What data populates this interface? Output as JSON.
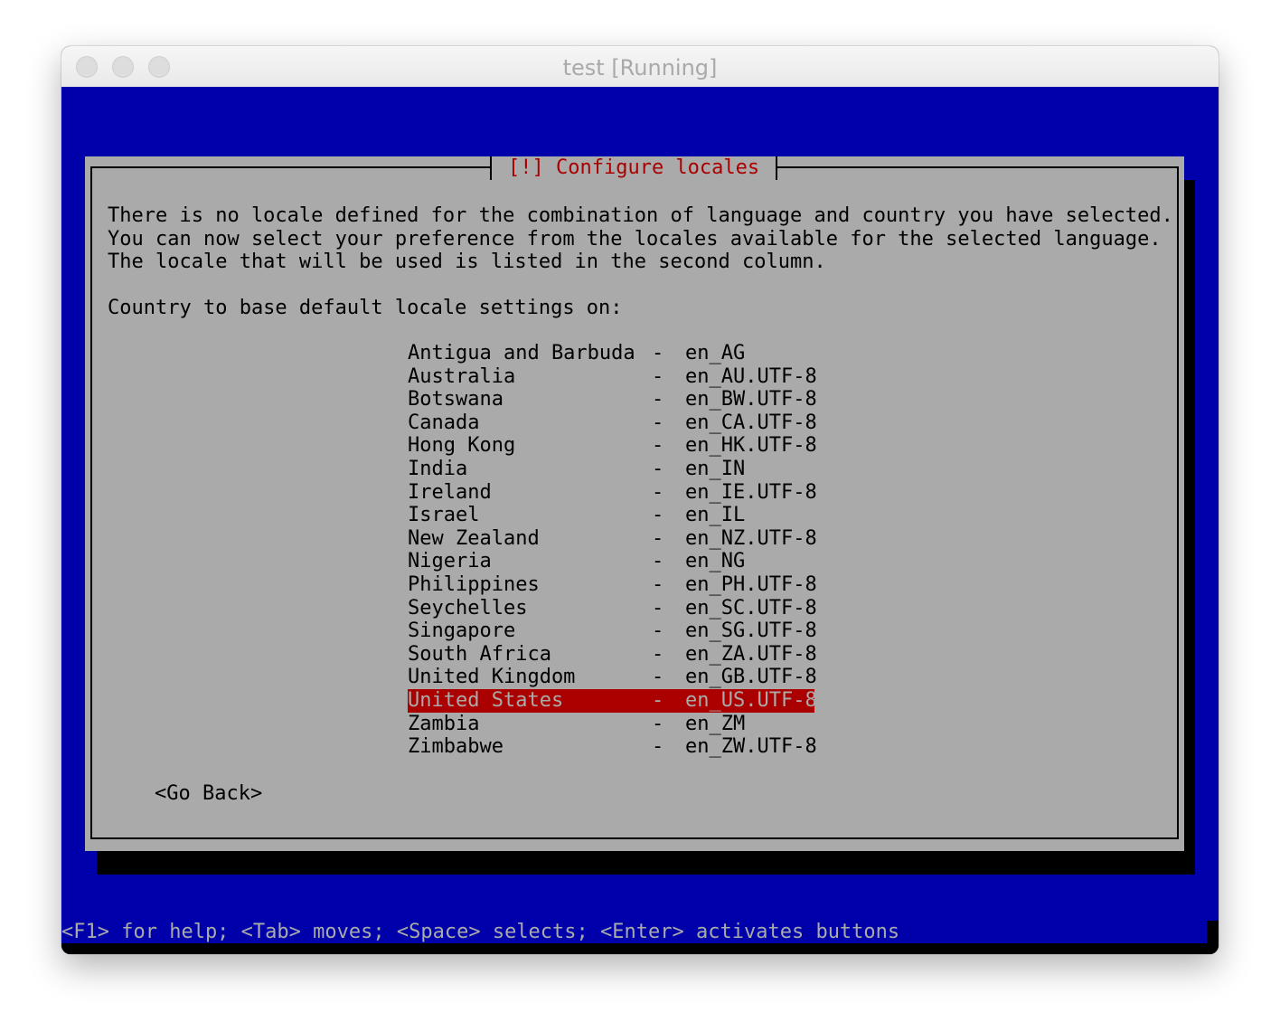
{
  "window": {
    "title": "test [Running]"
  },
  "dialog": {
    "title": "[!] Configure locales",
    "paragraph": [
      "There is no locale defined for the combination of language and country you have selected.",
      "You can now select your preference from the locales available for the selected language.",
      "The locale that will be used is listed in the second column."
    ],
    "prompt": "Country to base default locale settings on:",
    "separator": "-",
    "locales": [
      {
        "country": "Antigua and Barbuda",
        "code": "en_AG"
      },
      {
        "country": "Australia",
        "code": "en_AU.UTF-8"
      },
      {
        "country": "Botswana",
        "code": "en_BW.UTF-8"
      },
      {
        "country": "Canada",
        "code": "en_CA.UTF-8"
      },
      {
        "country": "Hong Kong",
        "code": "en_HK.UTF-8"
      },
      {
        "country": "India",
        "code": "en_IN"
      },
      {
        "country": "Ireland",
        "code": "en_IE.UTF-8"
      },
      {
        "country": "Israel",
        "code": "en_IL"
      },
      {
        "country": "New Zealand",
        "code": "en_NZ.UTF-8"
      },
      {
        "country": "Nigeria",
        "code": "en_NG"
      },
      {
        "country": "Philippines",
        "code": "en_PH.UTF-8"
      },
      {
        "country": "Seychelles",
        "code": "en_SC.UTF-8"
      },
      {
        "country": "Singapore",
        "code": "en_SG.UTF-8"
      },
      {
        "country": "South Africa",
        "code": "en_ZA.UTF-8"
      },
      {
        "country": "United Kingdom",
        "code": "en_GB.UTF-8"
      },
      {
        "country": "United States",
        "code": "en_US.UTF-8",
        "selected": true
      },
      {
        "country": "Zambia",
        "code": "en_ZM"
      },
      {
        "country": "Zimbabwe",
        "code": "en_ZW.UTF-8"
      }
    ],
    "go_back_label": "<Go Back>"
  },
  "footer": {
    "help_text": "<F1> for help; <Tab> moves; <Space> selects; <Enter> activates buttons"
  },
  "colors": {
    "screen_blue": "#0000aa",
    "dialog_gray": "#aaaaaa",
    "accent_red": "#aa0000",
    "shadow_black": "#000000"
  }
}
